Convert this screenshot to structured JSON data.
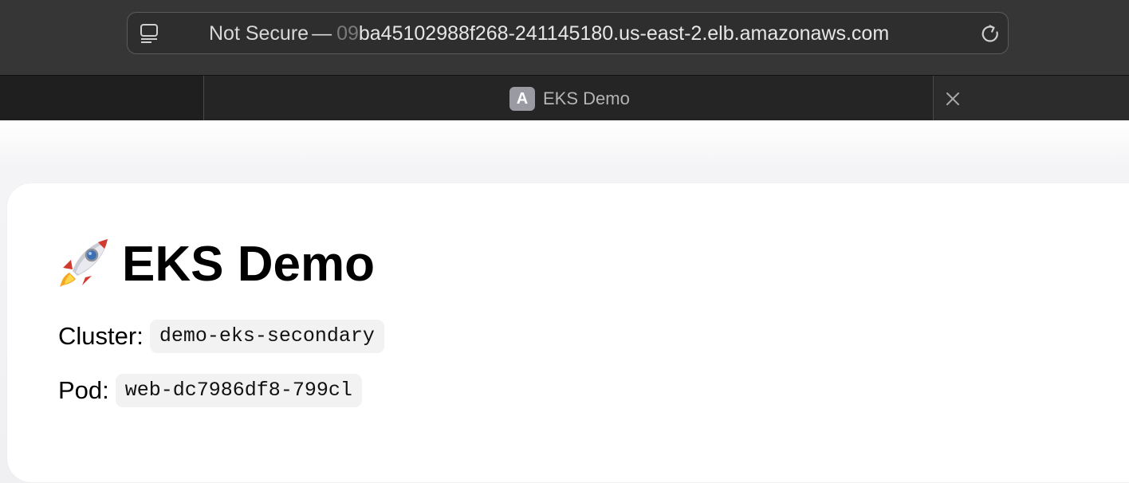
{
  "browser": {
    "address_bar": {
      "security_label": "Not Secure",
      "separator": "—",
      "url_faded_prefix": "09",
      "url_main": "ba45102988f268-241145180.us-east-2.elb.amazonaws.com"
    },
    "tab": {
      "favicon_letter": "A",
      "title": "EKS Demo"
    }
  },
  "page": {
    "heading_icon": "rocket-icon",
    "heading": "EKS Demo",
    "cluster": {
      "label": "Cluster:",
      "value": "demo-eks-secondary"
    },
    "pod": {
      "label": "Pod:",
      "value": "web-dc7986df8-799cl"
    }
  },
  "colors": {
    "toolbar_bg": "#363636",
    "tabstrip_bg": "#1f1f1f",
    "chip_bg": "#f2f2f2",
    "text": "#000000"
  }
}
